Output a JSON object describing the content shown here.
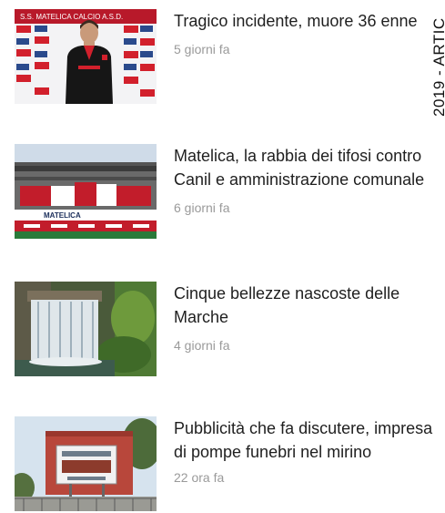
{
  "side_label": "2019 - ARTIC",
  "articles": [
    {
      "title": "Tragico incidente, muore 36 enne",
      "time": "5 giorni fa",
      "thumbnail": "player-photo"
    },
    {
      "title": "Matelica, la rabbia dei tifosi contro Canil e amministrazione comunale",
      "time": "6 giorni fa",
      "thumbnail": "stadium-stand-photo"
    },
    {
      "title": "Cinque bellezze nascoste delle Marche",
      "time": "4 giorni fa",
      "thumbnail": "waterfall-photo"
    },
    {
      "title": "Pubblicità che fa discutere, impresa di pompe funebri nel mirino",
      "time": "22 ora fa",
      "thumbnail": "billboard-photo"
    }
  ],
  "thumbnail_texts": {
    "player_backdrop": "S.S. MATELICA CALCIO A.S.D.",
    "stadium_banner": "MATELICA"
  }
}
